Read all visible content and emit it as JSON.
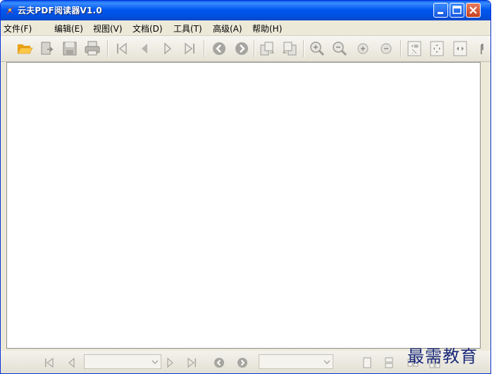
{
  "window": {
    "title": "云夫PDF阅读器V1.0"
  },
  "menu": [
    "文件(F)",
    "编辑(E)",
    "视图(V)",
    "文档(D)",
    "工具(T)",
    "高级(A)",
    "帮助(H)"
  ],
  "watermark": "最需教育",
  "colors": {
    "titlebar": "#0058EE",
    "chrome": "#ECE9D8",
    "folder": "#F2B01E"
  }
}
